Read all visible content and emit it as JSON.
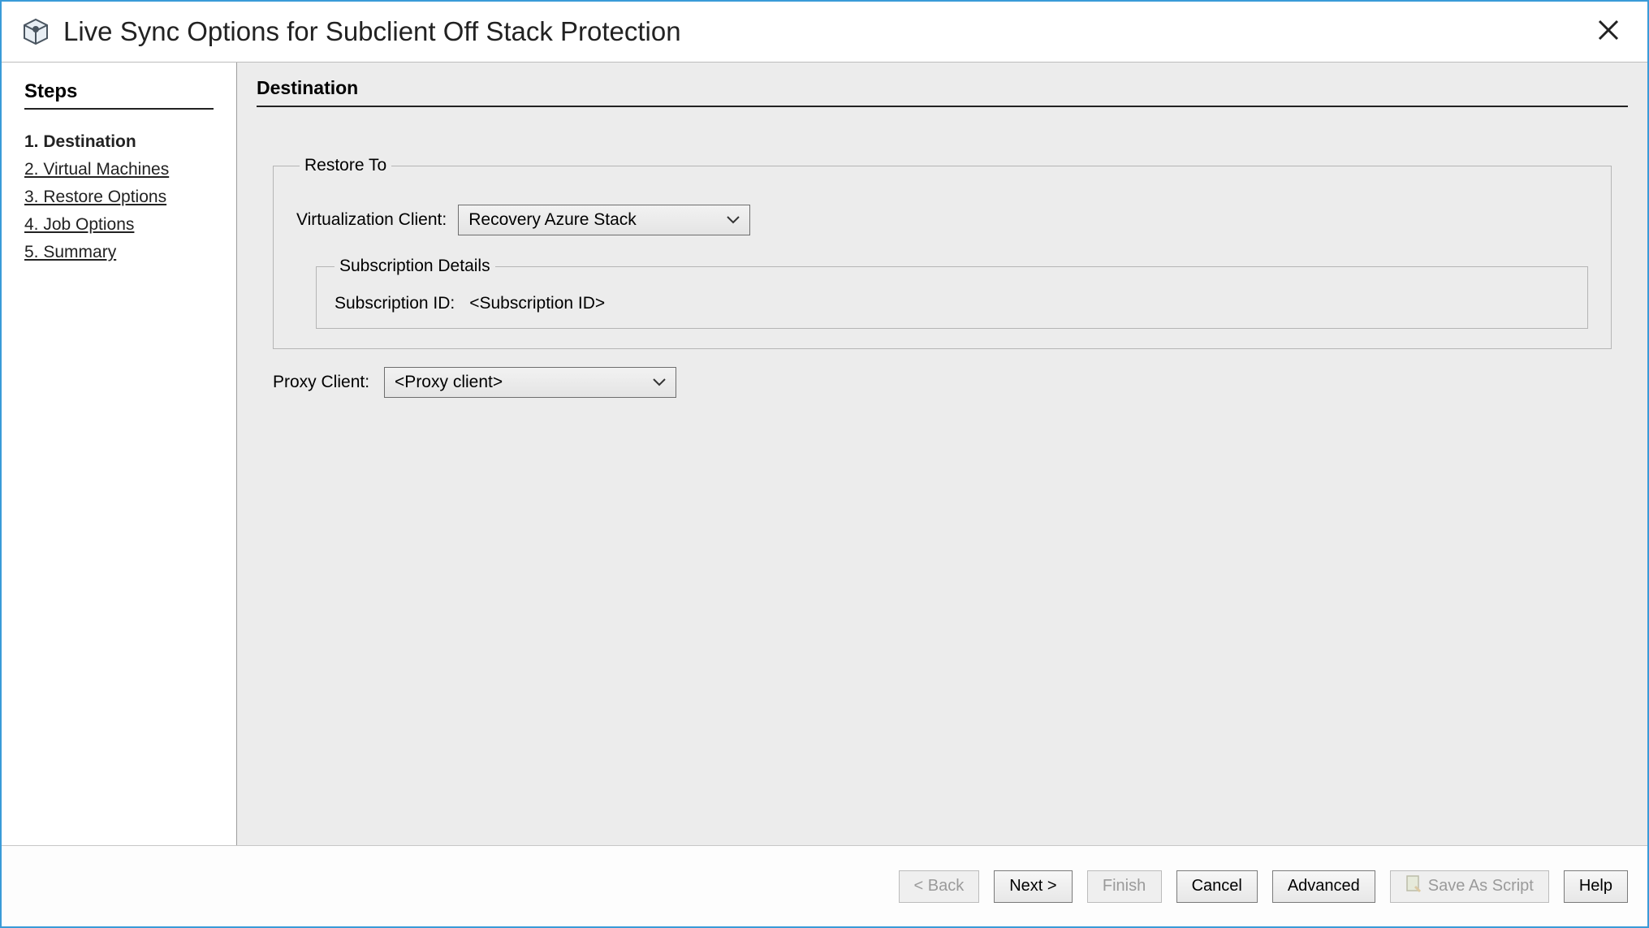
{
  "window": {
    "title": "Live Sync Options for Subclient Off Stack Protection"
  },
  "sidebar": {
    "heading": "Steps",
    "steps": [
      {
        "label": "1. Destination",
        "active": true
      },
      {
        "label": "2. Virtual Machines",
        "active": false
      },
      {
        "label": "3. Restore Options",
        "active": false
      },
      {
        "label": "4. Job Options",
        "active": false
      },
      {
        "label": "5. Summary",
        "active": false
      }
    ]
  },
  "main": {
    "page_title": "Destination",
    "restore_to": {
      "legend": "Restore To",
      "virt_client_label": "Virtualization Client:",
      "virt_client_value": "Recovery Azure Stack",
      "sub_details_legend": "Subscription Details",
      "sub_id_label": "Subscription ID:",
      "sub_id_value": "<Subscription ID>"
    },
    "proxy": {
      "label": "Proxy Client:",
      "value": "<Proxy client>"
    }
  },
  "footer": {
    "back": "< Back",
    "next": "Next >",
    "finish": "Finish",
    "cancel": "Cancel",
    "advanced": "Advanced",
    "save_as_script": "Save As Script",
    "help": "Help"
  }
}
